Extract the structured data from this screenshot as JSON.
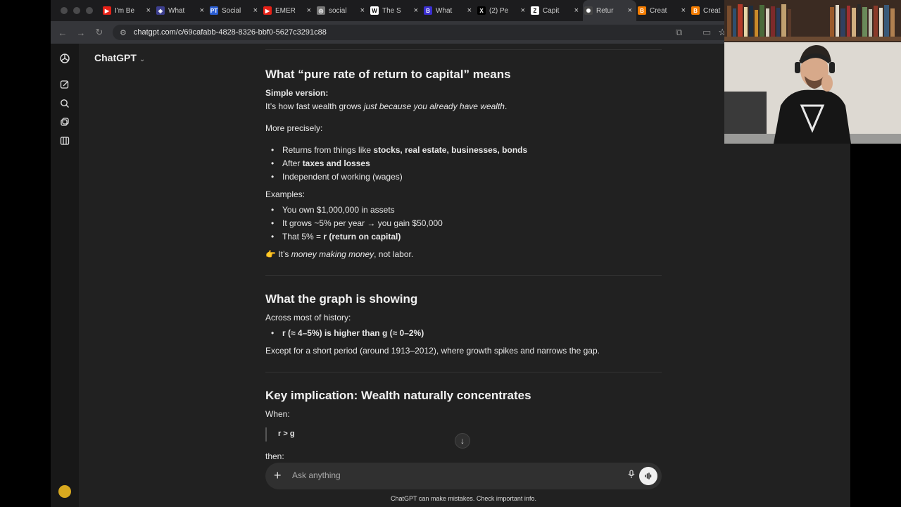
{
  "tabs": [
    {
      "title": "I'm Be",
      "favicon": "youtube-icon",
      "color": "#e62117",
      "glyph": "▶"
    },
    {
      "title": "What",
      "favicon": "shield-icon",
      "color": "#3d3f8f",
      "glyph": "◈"
    },
    {
      "title": "Social",
      "favicon": "pt-icon",
      "color": "#2c5fd4",
      "glyph": "PT"
    },
    {
      "title": "EMER",
      "favicon": "youtube-icon",
      "color": "#e62117",
      "glyph": "▶"
    },
    {
      "title": "social",
      "favicon": "globe-icon",
      "color": "#777777",
      "glyph": "◎"
    },
    {
      "title": "The S",
      "favicon": "wikipedia-icon",
      "color": "#ffffff",
      "glyph": "W"
    },
    {
      "title": "What",
      "favicon": "bookmark-icon",
      "color": "#3b2fd0",
      "glyph": "B"
    },
    {
      "title": "(2) Pe",
      "favicon": "x-icon",
      "color": "#000000",
      "glyph": "X"
    },
    {
      "title": "Capit",
      "favicon": "notion-icon",
      "color": "#ffffff",
      "glyph": "Z"
    },
    {
      "title": "Retur",
      "favicon": "chatgpt-icon",
      "color": "#444444",
      "glyph": "✺",
      "active": true
    },
    {
      "title": "Creat",
      "favicon": "blogger-icon",
      "color": "#f57d00",
      "glyph": "B"
    },
    {
      "title": "Creat",
      "favicon": "blogger-icon",
      "color": "#f57d00",
      "glyph": "B"
    }
  ],
  "url": "chatgpt.com/c/69cafabb-4828-8326-bbf0-5627c3291c88",
  "app": {
    "brand": "ChatGPT"
  },
  "article": {
    "s1": {
      "heading": "What “pure rate of return to capital” means",
      "simple_label": "Simple version:",
      "simple_pre": "It’s how fast wealth grows ",
      "simple_em": "just because you already have wealth",
      "simple_post": ".",
      "precisely": "More precisely:",
      "b1_pre": "Returns from things like ",
      "b1_bold": "stocks, real estate, businesses, bonds",
      "b2_pre": "After ",
      "b2_bold": "taxes and losses",
      "b3": "Independent of working (wages)",
      "examples": "Examples:",
      "e1": "You own $1,000,000 in assets",
      "e2": "It grows ~5% per year → you gain $50,000",
      "e3_pre": "That 5% = ",
      "e3_bold": "r (return on capital)",
      "pointer": "👉",
      "summary_pre": " It’s ",
      "summary_em": "money making money",
      "summary_post": ", not labor."
    },
    "s2": {
      "heading": "What the graph is showing",
      "history": "Across most of history:",
      "bullet": "r (≈ 4–5%) is higher than g (≈ 0–2%)",
      "except": "Except for a short period (around 1913–2012), where growth spikes and narrows the gap."
    },
    "s3": {
      "heading": "Key implication: Wealth naturally concentrates",
      "when": "When:",
      "formula": "r > g",
      "then": "then:"
    }
  },
  "composer": {
    "placeholder": "Ask anything"
  },
  "disclaimer": "ChatGPT can make mistakes. Check important info."
}
